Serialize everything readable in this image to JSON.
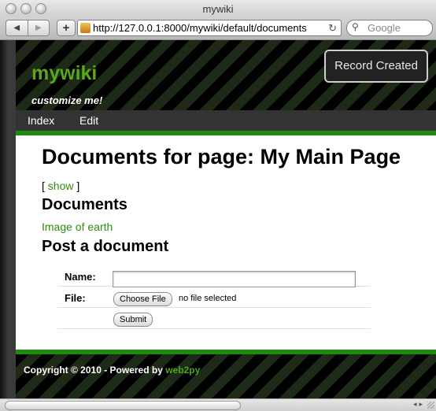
{
  "browser": {
    "window_title": "mywiki",
    "url": "http://127.0.0.1:8000/mywiki/default/documents",
    "search_placeholder": "Google"
  },
  "header": {
    "logo": "mywiki",
    "slogan": "customize me!",
    "flash": "Record Created"
  },
  "menu": {
    "items": [
      {
        "label": "Index"
      },
      {
        "label": "Edit"
      }
    ]
  },
  "content": {
    "title": "Documents for page: My Main Page",
    "toggle_open": "[",
    "toggle_link": "show",
    "toggle_close": "]",
    "documents_heading": "Documents",
    "documents": [
      {
        "label": "Image of earth"
      }
    ],
    "post_heading": "Post a document",
    "form": {
      "name_label": "Name:",
      "name_value": "",
      "file_label": "File:",
      "choose_file_label": "Choose File",
      "no_file_text": "no file selected",
      "submit_label": "Submit"
    }
  },
  "footer": {
    "copyright": "Copyright © 2010 - Powered by",
    "powered_link": "web2py"
  },
  "colors": {
    "accent_green": "#1e8a0f",
    "link_green": "#2e8b0f",
    "header_dark": "#000000"
  }
}
